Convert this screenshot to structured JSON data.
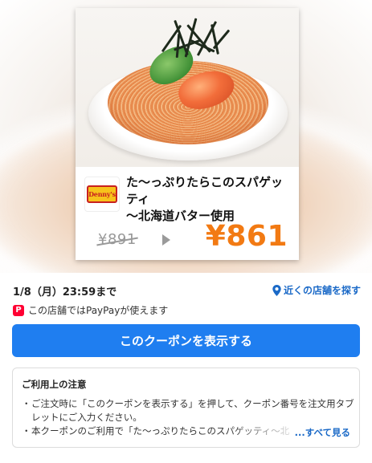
{
  "coupon": {
    "title_line1": "た〜っぷりたらこのスパゲッティ",
    "title_line2": "〜北海道バター使用",
    "old_price": "¥891",
    "new_price": "¥861",
    "brand_logo_text": "Denny's"
  },
  "info": {
    "expiry": "1/8（月）23:59まで",
    "nearby_label": "近くの店舗を探す",
    "paypay_text": "この店舗ではPayPayが使えます",
    "paypay_icon_letter": "P"
  },
  "actions": {
    "show_coupon": "このクーポンを表示する"
  },
  "notes": {
    "title": "ご利用上の注意",
    "item1": "ご注文時に「このクーポンを表示する」を押して、クーポン番号を注文用タブレットにご入力ください。",
    "item2": "本クーポンのご利用で「た〜っぷりたらこのスパゲッティ〜北",
    "bullet": "・",
    "see_all": "...すべて見る"
  },
  "colors": {
    "accent_blue": "#1f7ef0",
    "price_orange": "#f27a13",
    "link_blue": "#1a69c7",
    "paypay_red": "#ff0033"
  }
}
